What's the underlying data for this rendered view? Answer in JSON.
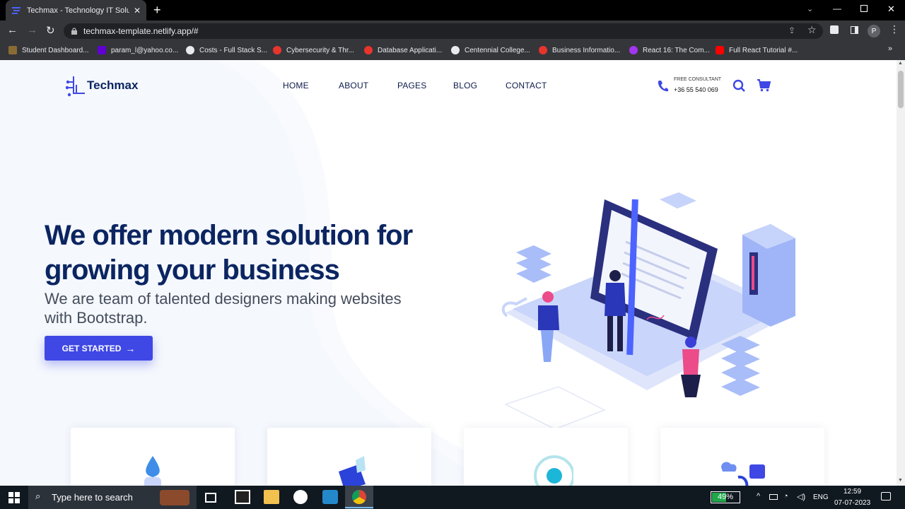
{
  "browser": {
    "tab_title": "Techmax - Technology IT Solution",
    "url": "techmax-template.netlify.app/#",
    "profile_initial": "P",
    "bookmarks": [
      {
        "label": "Student Dashboard...",
        "icon": "folder-icon",
        "color": "#8b6b34"
      },
      {
        "label": "param_l@yahoo.co...",
        "icon": "yahoo-icon",
        "color": "#6001d2"
      },
      {
        "label": "Costs - Full Stack S...",
        "icon": "site-icon",
        "color": "#e8eaed"
      },
      {
        "label": "Cybersecurity & Thr...",
        "icon": "s-logo-icon",
        "color": "#e8352c"
      },
      {
        "label": "Database Applicati...",
        "icon": "s-logo-icon",
        "color": "#e8352c"
      },
      {
        "label": "Centennial College...",
        "icon": "c-logo-icon",
        "color": "#e8eaed"
      },
      {
        "label": "Business Informatio...",
        "icon": "s-logo-icon",
        "color": "#e8352c"
      },
      {
        "label": "React 16: The Com...",
        "icon": "udemy-icon",
        "color": "#a435f0"
      },
      {
        "label": "Full React Tutorial #...",
        "icon": "youtube-icon",
        "color": "#ff0000"
      }
    ],
    "overflow": "»"
  },
  "site": {
    "logo_text": "Techmax",
    "nav": [
      "HOME",
      "ABOUT",
      "PAGES",
      "BLOG",
      "CONTACT"
    ],
    "consult_label": "FREE CONSULTANT",
    "phone": "+36 55 540 069",
    "hero_title": "We offer modern solution for growing your business",
    "hero_subtitle": "We are team of talented designers making websites with Bootstrap.",
    "cta_label": "GET STARTED",
    "accent": "#3f48e4",
    "heading_color": "#0b2561"
  },
  "taskbar": {
    "search_placeholder": "Type here to search",
    "battery": "49%",
    "language": "ENG",
    "time": "12:59",
    "date": "07-07-2023"
  }
}
